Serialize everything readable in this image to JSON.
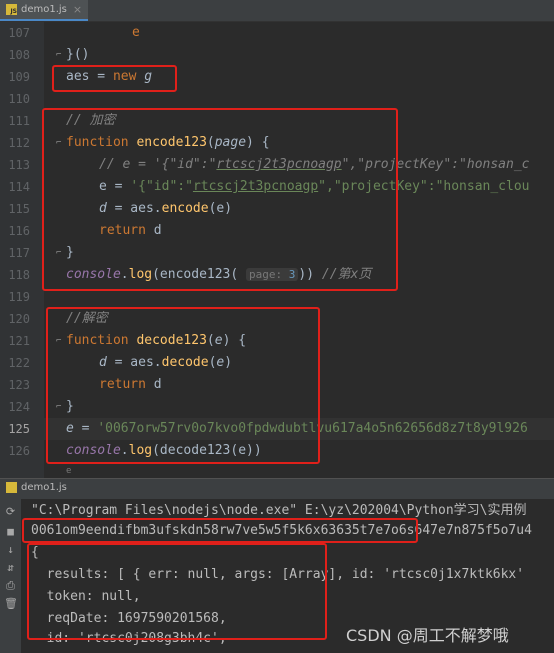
{
  "editor": {
    "tab": {
      "icon": "js-file-icon",
      "label": "demo1.js",
      "close": "×"
    },
    "lines": [
      {
        "n": "107",
        "t": ""
      },
      {
        "n": "108",
        "t": ""
      },
      {
        "n": "109",
        "t": ""
      },
      {
        "n": "110",
        "t": ""
      },
      {
        "n": "111",
        "t": ""
      },
      {
        "n": "112",
        "t": ""
      },
      {
        "n": "113",
        "t": ""
      },
      {
        "n": "114",
        "t": ""
      },
      {
        "n": "115",
        "t": ""
      },
      {
        "n": "116",
        "t": ""
      },
      {
        "n": "117",
        "t": ""
      },
      {
        "n": "118",
        "t": ""
      },
      {
        "n": "119",
        "t": ""
      },
      {
        "n": "120",
        "t": ""
      },
      {
        "n": "121",
        "t": ""
      },
      {
        "n": "122",
        "t": ""
      },
      {
        "n": "123",
        "t": ""
      },
      {
        "n": "124",
        "t": ""
      },
      {
        "n": "125",
        "t": ""
      },
      {
        "n": "126",
        "t": ""
      }
    ],
    "code": {
      "l107": "e",
      "l108": "}()",
      "l109": {
        "a": "aes",
        "b": " = ",
        "c": "new",
        "d": " g"
      },
      "l111": "// 加密",
      "l112": {
        "a": "function",
        "b": " encode123",
        "c": "(",
        "d": "page",
        "e": ") {"
      },
      "l113": {
        "a": "// e = '{\"id\":\"",
        "b": "rtcscj2t3pcnoagp",
        "c": "\",\"projectKey\":\"honsan_c"
      },
      "l114": {
        "a": "e",
        "b": " = ",
        "c": "'{\"id\":\"",
        "d": "rtcscj2t3pcnoagp",
        "e": "\",\"projectKey\":\"honsan_clou"
      },
      "l115": {
        "a": "d",
        "b": " = aes.",
        "c": "encode",
        "d": "(e)"
      },
      "l116": {
        "a": "return",
        "b": " d"
      },
      "l117": "}",
      "l118": {
        "a": "console",
        "b": ".",
        "c": "log",
        "d": "(encode123( ",
        "e": "page:",
        "f": " 3",
        "g": ")) ",
        "h": "//第x页"
      },
      "l120": "//解密",
      "l121": {
        "a": "function",
        "b": " decode123",
        "c": "(",
        "d": "e",
        "e": ") {"
      },
      "l122": {
        "a": "d",
        "b": " = aes.",
        "c": "decode",
        "d": "(",
        "e": "e",
        "f": ")"
      },
      "l123": {
        "a": "return",
        "b": " d"
      },
      "l124": "}",
      "l125": {
        "a": "e",
        "b": " = ",
        "c": "'0067orw57rv0o7kvo0fpdwdubtlvu617a4o5n62656d8z7t8y9l926"
      },
      "l126": {
        "a": "console",
        "b": ".",
        "c": "log",
        "d": "(decode123(e))"
      },
      "l127": "e"
    }
  },
  "run": {
    "tab": {
      "icon": "js-file-icon",
      "label": "demo1.js"
    },
    "side_icons": [
      "rerun-icon",
      "stop-icon",
      "step-icon",
      "scroll-icon",
      "print-icon",
      "trash-icon"
    ],
    "console_lines": [
      "\"C:\\Program Files\\nodejs\\node.exe\" E:\\yz\\202004\\Python学习\\实用例",
      "0061om9eendifbm3ufskdn58rw7ve5w5f5k6x63635t7e7o6s647e7n875f5o7u4",
      "{",
      "  results: [ { err: null, args: [Array], id: 'rtcsc0j1x7ktk6kx'",
      "  token: null,",
      "  reqDate: 1697590201568,",
      "  id: 'rtcsc0j208g3bh4c',"
    ]
  },
  "watermark": "CSDN @周工不解梦哦",
  "colors": {
    "annotation": "#e0201a",
    "background": "#2b2b2b"
  }
}
